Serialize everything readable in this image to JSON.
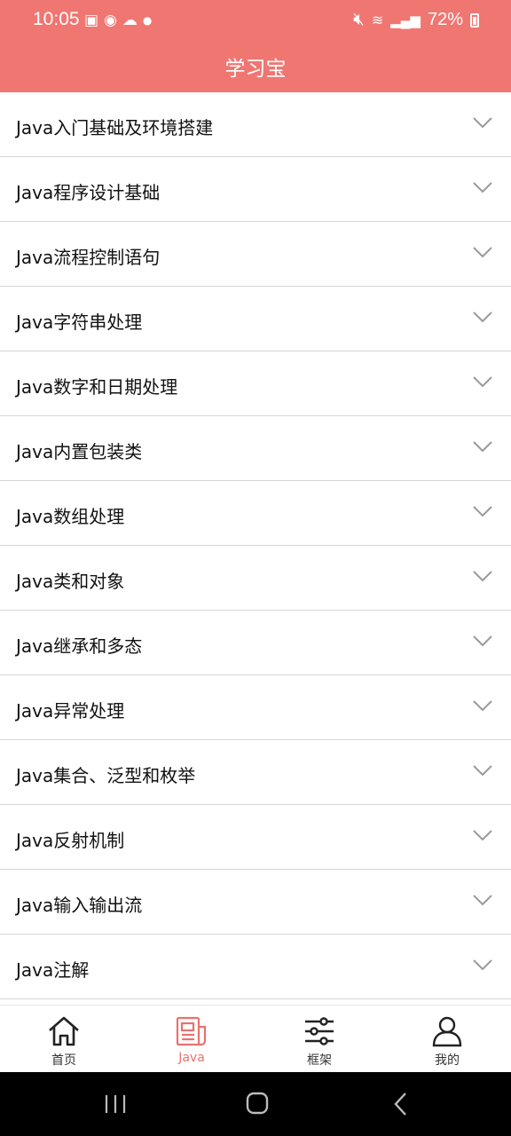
{
  "status": {
    "time": "10:05",
    "battery": "72%"
  },
  "header": {
    "title": "学习宝"
  },
  "topics": [
    "Java入门基础及环境搭建",
    "Java程序设计基础",
    "Java流程控制语句",
    "Java字符串处理",
    "Java数字和日期处理",
    "Java内置包装类",
    "Java数组处理",
    "Java类和对象",
    "Java继承和多态",
    "Java异常处理",
    "Java集合、泛型和枚举",
    "Java反射机制",
    "Java输入输出流",
    "Java注解"
  ],
  "tabs": [
    {
      "label": "首页",
      "icon": "home-icon",
      "active": false
    },
    {
      "label": "Java",
      "icon": "article-icon",
      "active": true
    },
    {
      "label": "框架",
      "icon": "sliders-icon",
      "active": false
    },
    {
      "label": "我的",
      "icon": "user-icon",
      "active": false
    }
  ],
  "colors": {
    "accent": "#f07672",
    "active_tab": "#e9726e",
    "divider": "#d5d5d5"
  }
}
